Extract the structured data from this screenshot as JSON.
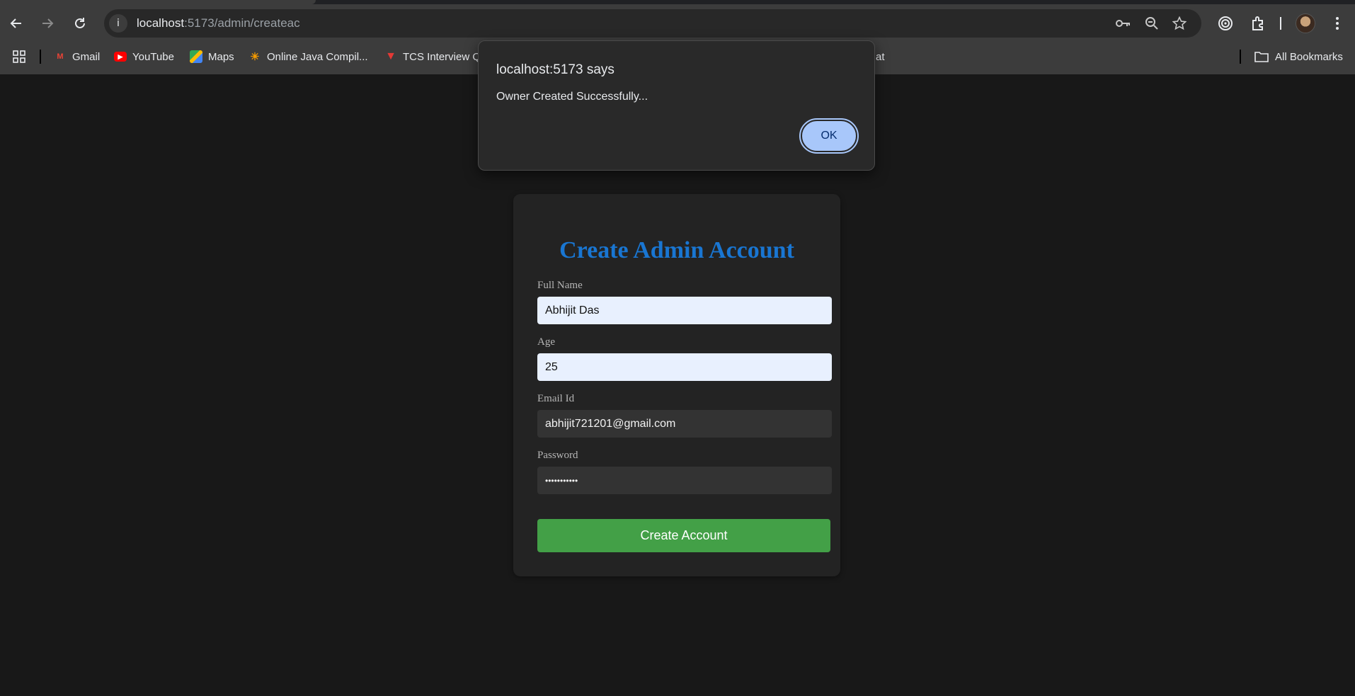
{
  "browser": {
    "url_host": "localhost",
    "url_path": ":5173/admin/createac",
    "bookmarks": [
      {
        "label": "Gmail",
        "icon": "gmail-icon",
        "color": "#ea4335"
      },
      {
        "label": "YouTube",
        "icon": "youtube-icon",
        "color": "#ff0000"
      },
      {
        "label": "Maps",
        "icon": "maps-icon",
        "color": "#34a853"
      },
      {
        "label": "Online Java Compil...",
        "icon": "sun-icon",
        "color": "#f29900"
      },
      {
        "label": "TCS Interview Q",
        "icon": "tcs-icon",
        "color": "#e53935"
      },
      {
        "label": "at",
        "icon": "",
        "color": ""
      }
    ],
    "all_bookmarks_label": "All Bookmarks"
  },
  "dialog": {
    "title": "localhost:5173 says",
    "message": "Owner Created Successfully...",
    "ok_label": "OK"
  },
  "form": {
    "title": "Create Admin Account",
    "title_color": "#1976d2",
    "fields": [
      {
        "label": "Full Name",
        "value": "Abhijit Das"
      },
      {
        "label": "Age",
        "value": "25"
      },
      {
        "label": "Email Id",
        "value": "abhijit721201@gmail.com"
      },
      {
        "label": "Password",
        "value": "•••••••••••"
      }
    ],
    "submit_label": "Create Account",
    "submit_color": "#43a047"
  }
}
